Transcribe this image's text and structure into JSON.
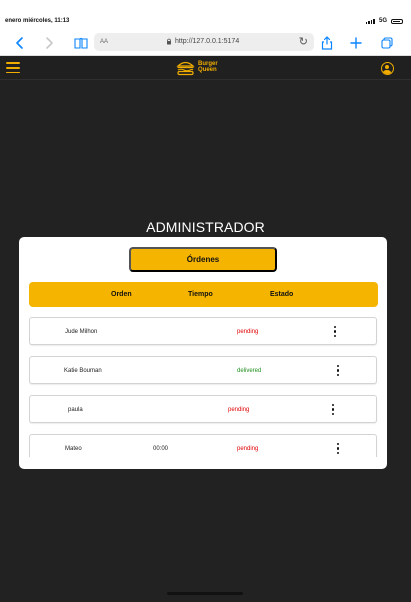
{
  "status_bar": {
    "time_date": "enero miércoles, 11:13",
    "network": "5G"
  },
  "browser": {
    "text_size_label": "AA",
    "url": "http://127.0.0.1:5174",
    "icons": {
      "back": "chevron-left-icon",
      "forward": "chevron-right-icon",
      "reader": "book-icon",
      "lock": "lock-icon",
      "reload": "reload-icon",
      "share": "share-icon",
      "new_tab": "plus-icon",
      "tabs": "tabs-icon"
    }
  },
  "app": {
    "brand": {
      "line1": "Burger",
      "line2": "Queen"
    },
    "icons": {
      "menu": "menu-icon",
      "logo": "burger-icon",
      "profile": "user-circle-icon",
      "row_actions": "more-vertical-icon"
    },
    "page_title": "ADMINISTRADOR",
    "orders_button": "Órdenes",
    "table_headers": {
      "orden": "Orden",
      "tiempo": "Tiempo",
      "estado": "Estado"
    },
    "orders": [
      {
        "client": "Jude Milhon",
        "time": "",
        "status": "pending"
      },
      {
        "client": "Katie Bouman",
        "time": "",
        "status": "delivered"
      },
      {
        "client": "paula",
        "time": "",
        "status": "pending"
      },
      {
        "client": "Mateo",
        "time": "00:00",
        "status": "pending"
      }
    ]
  },
  "colors": {
    "accent": "#f4b400",
    "pending": "#e00000",
    "delivered": "#1e8f1e",
    "background": "#222222",
    "browser_blue": "#0a84ff"
  }
}
